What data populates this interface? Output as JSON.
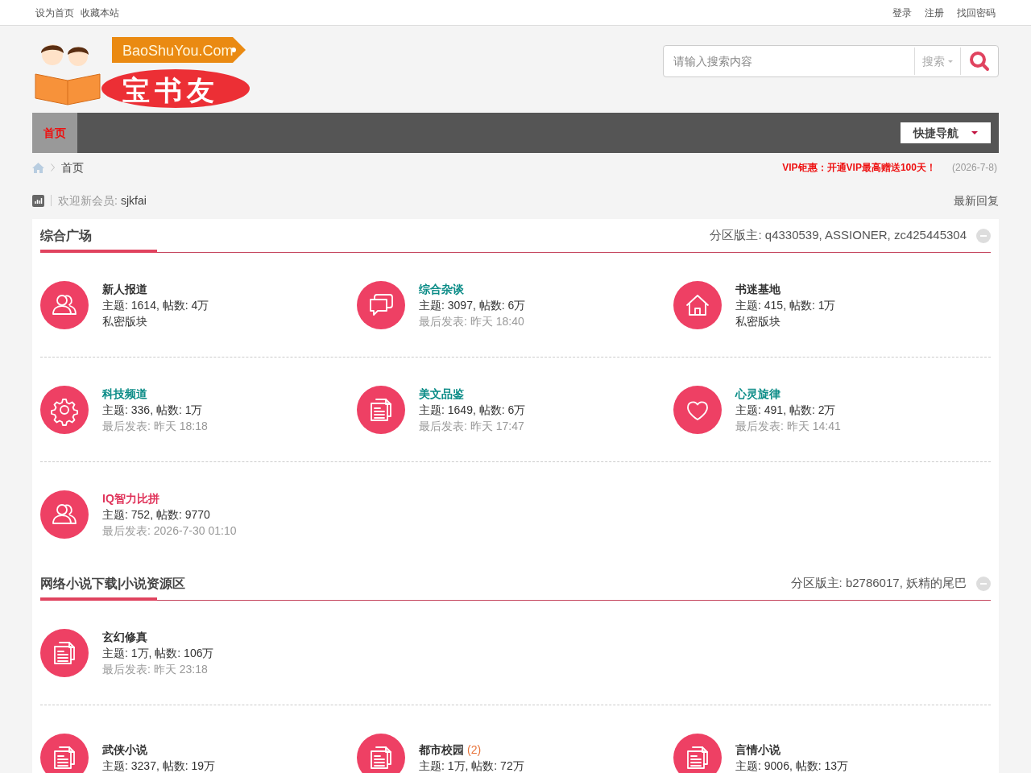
{
  "top_bar": {
    "left_links": [
      "设为首页",
      "收藏本站"
    ],
    "right_links": [
      "登录",
      "注册",
      "找回密码"
    ]
  },
  "logo": {
    "domain": "BaoShuYou.Com",
    "name": "宝书友"
  },
  "search": {
    "placeholder": "请输入搜索内容",
    "type_label": "搜索"
  },
  "nav": {
    "items": [
      {
        "label": "首页",
        "selected": true
      }
    ],
    "quick_nav": "快捷导航"
  },
  "breadcrumb": {
    "current": "首页",
    "promo": "VIP钜惠：开通VIP最高赠送100天！",
    "date": "(2026-7-8)"
  },
  "stats": {
    "welcome_label": "欢迎新会员:",
    "new_member": "sjkfai",
    "latest_replies": "最新回复"
  },
  "sections": [
    {
      "title": "综合广场",
      "moderators": "分区版主: q4330539, ASSIONER, zc425445304",
      "expanded": true,
      "rows": [
        [
          {
            "kind": "users",
            "name": "新人报道",
            "color": "#333333",
            "stats": "主题: 1614, 帖数: 4万",
            "private_note": "私密版块"
          },
          {
            "kind": "chat",
            "name": "综合杂谈",
            "color": "#0b8c87",
            "stats": "主题: 3097, 帖数: 6万",
            "last_post": "最后发表: 昨天 18:40"
          },
          {
            "kind": "home",
            "name": "书迷基地",
            "color": "#333333",
            "stats": "主题: 415, 帖数: 1万",
            "private_note": "私密版块"
          }
        ],
        [
          {
            "kind": "gear",
            "name": "科技频道",
            "color": "#0b8c87",
            "stats": "主题: 336, 帖数: 1万",
            "last_post": "最后发表: 昨天 18:18"
          },
          {
            "kind": "docs",
            "name": "美文品鉴",
            "color": "#0b8c87",
            "stats": "主题: 1649, 帖数: 6万",
            "last_post": "最后发表: 昨天 17:47"
          },
          {
            "kind": "heart",
            "name": "心灵旋律",
            "color": "#0b8c87",
            "stats": "主题: 491, 帖数: 2万",
            "last_post": "最后发表: 昨天 14:41"
          }
        ],
        [
          {
            "kind": "users",
            "name": "IQ智力比拼",
            "color": "#e0335a",
            "stats": "主题: 752, 帖数: 9770",
            "last_post": "最后发表: 2026-7-30 01:10"
          }
        ]
      ]
    },
    {
      "title": "网络小说下载|小说资源区",
      "moderators": "分区版主: b2786017, 妖精的尾巴",
      "expanded": true,
      "rows": [
        [
          {
            "kind": "docs",
            "name": "玄幻修真",
            "color": "#333333",
            "stats": "主题: 1万, 帖数: 106万",
            "last_post": "最后发表: 昨天 23:18"
          }
        ],
        [
          {
            "kind": "docs",
            "name": "武侠小说",
            "color": "#333333",
            "stats": "主题: 3237, 帖数: 19万"
          },
          {
            "kind": "docs",
            "name": "都市校园",
            "color": "#333333",
            "new_count": "(2)",
            "stats": "主题: 1万, 帖数: 72万"
          },
          {
            "kind": "docs",
            "name": "言情小说",
            "color": "#333333",
            "stats": "主题: 9006, 帖数: 13万"
          }
        ]
      ]
    }
  ]
}
